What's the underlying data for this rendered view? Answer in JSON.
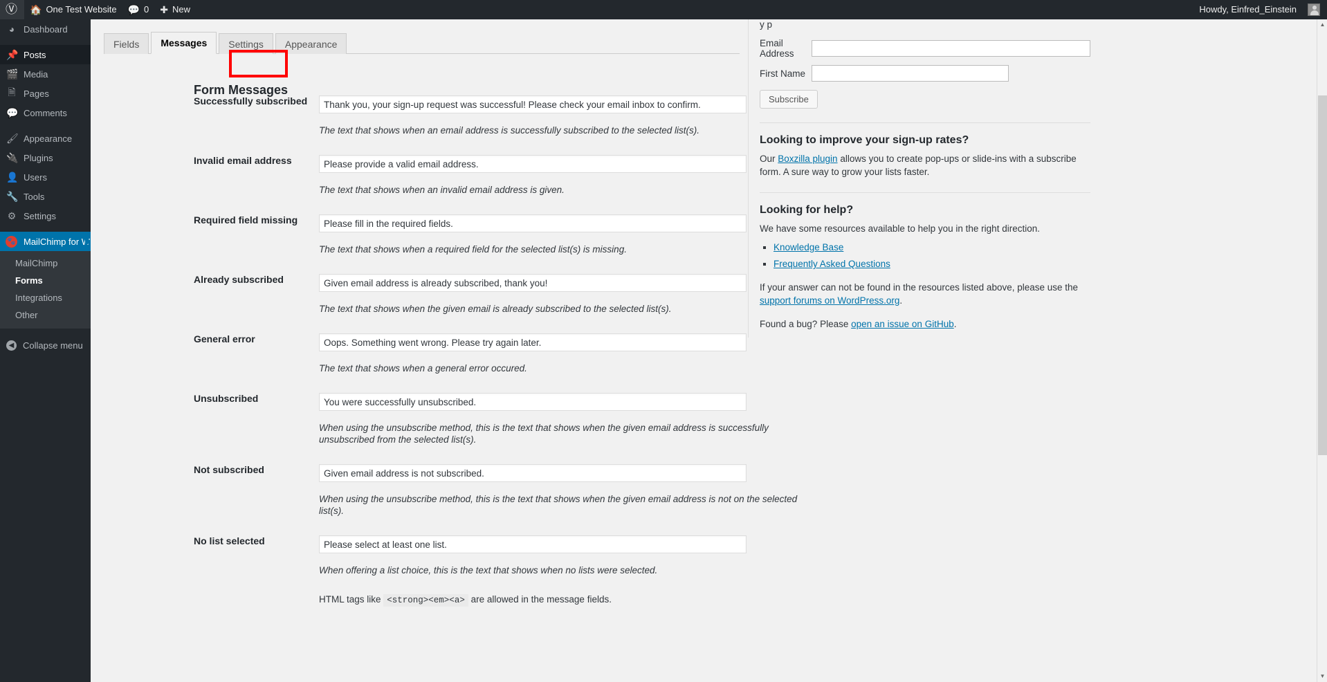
{
  "adminbar": {
    "wp_logo_icon": "wordpress-logo-icon",
    "site_name": "One Test Website",
    "home_icon": "home-icon",
    "comments_icon": "comment-bubble-icon",
    "comments_count": "0",
    "new_icon": "plus-icon",
    "new_label": "New",
    "howdy": "Howdy, Einfred_Einstein"
  },
  "sidebar": {
    "items": [
      {
        "label": "Dashboard",
        "icon": "dashboard-icon"
      },
      {
        "label": "Posts",
        "icon": "pin-icon"
      },
      {
        "label": "Media",
        "icon": "media-icon"
      },
      {
        "label": "Pages",
        "icon": "pages-icon"
      },
      {
        "label": "Comments",
        "icon": "comment-bubble-icon"
      },
      {
        "label": "Appearance",
        "icon": "paintbrush-icon"
      },
      {
        "label": "Plugins",
        "icon": "plug-icon"
      },
      {
        "label": "Users",
        "icon": "user-icon"
      },
      {
        "label": "Tools",
        "icon": "wrench-icon"
      },
      {
        "label": "Settings",
        "icon": "sliders-icon"
      },
      {
        "label": "MailChimp for WP",
        "icon": "mailchimp-logo-icon"
      }
    ],
    "submenu": [
      {
        "label": "MailChimp"
      },
      {
        "label": "Forms"
      },
      {
        "label": "Integrations"
      },
      {
        "label": "Other"
      }
    ],
    "collapse_label": "Collapse menu",
    "collapse_icon": "chevron-left-circle-icon"
  },
  "tabs": [
    {
      "label": "Fields"
    },
    {
      "label": "Messages"
    },
    {
      "label": "Settings"
    },
    {
      "label": "Appearance"
    }
  ],
  "main": {
    "heading": "Form Messages",
    "html_note_prefix": "HTML tags like",
    "html_note_code": "<strong><em><a>",
    "html_note_suffix": "are allowed in the message fields.",
    "rows": [
      {
        "label": "Successfully subscribed",
        "value": "Thank you, your sign-up request was successful! Please check your email inbox to confirm.",
        "desc": "The text that shows when an email address is successfully subscribed to the selected list(s)."
      },
      {
        "label": "Invalid email address",
        "value": "Please provide a valid email address.",
        "desc": "The text that shows when an invalid email address is given."
      },
      {
        "label": "Required field missing",
        "value": "Please fill in the required fields.",
        "desc": "The text that shows when a required field for the selected list(s) is missing."
      },
      {
        "label": "Already subscribed",
        "value": "Given email address is already subscribed, thank you!",
        "desc": "The text that shows when the given email is already subscribed to the selected list(s)."
      },
      {
        "label": "General error",
        "value": "Oops. Something went wrong. Please try again later.",
        "desc": "The text that shows when a general error occured."
      },
      {
        "label": "Unsubscribed",
        "value": "You were successfully unsubscribed.",
        "desc": "When using the unsubscribe method, this is the text that shows when the given email address is successfully unsubscribed from the selected list(s)."
      },
      {
        "label": "Not subscribed",
        "value": "Given email address is not subscribed.",
        "desc": "When using the unsubscribe method, this is the text that shows when the given email address is not on the selected list(s)."
      },
      {
        "label": "No list selected",
        "value": "Please select at least one list.",
        "desc": "When offering a list choice, this is the text that shows when no lists were selected."
      }
    ]
  },
  "preview": {
    "cut_text": "y p",
    "email_label": "Email Address",
    "email_value": "",
    "first_name_label": "First Name",
    "first_name_value": "",
    "subscribe_label": "Subscribe",
    "improve_heading": "Looking to improve your sign-up rates?",
    "improve_text_1": "Our ",
    "improve_link": "Boxzilla plugin",
    "improve_text_2": " allows you to create pop-ups or slide-ins with a subscribe form. A sure way to grow your lists faster.",
    "help_heading": "Looking for help?",
    "help_text": "We have some resources available to help you in the right direction.",
    "help_links": [
      {
        "label": "Knowledge Base"
      },
      {
        "label": "Frequently Asked Questions"
      }
    ],
    "answer_text_1": "If your answer can not be found in the resources listed above, please use the ",
    "answer_link": "support forums on WordPress.org",
    "answer_text_2": ".",
    "bug_text_1": "Found a bug? Please ",
    "bug_link": "open an issue on GitHub",
    "bug_text_2": "."
  },
  "colors": {
    "admin_bar": "#23282d",
    "accent_blue": "#0073aa",
    "highlight_red": "#ff0000",
    "page_bg": "#f1f1f1"
  }
}
